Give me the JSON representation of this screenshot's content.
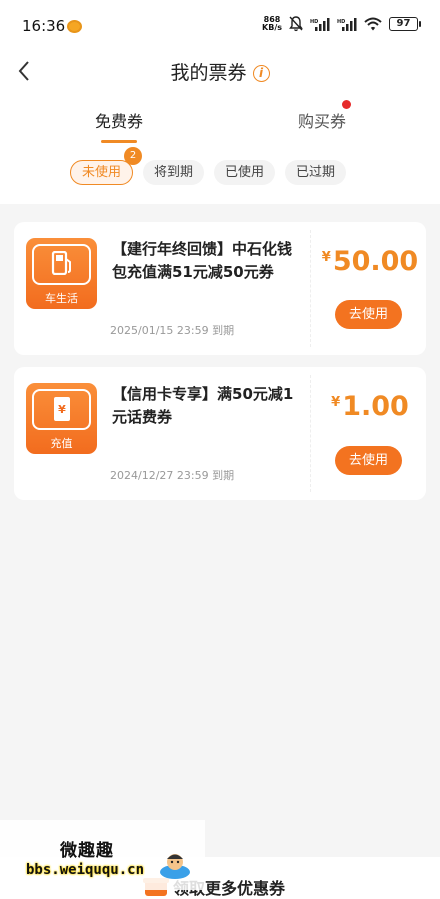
{
  "status_bar": {
    "time": "16:36",
    "speed_top": "868",
    "speed_bottom": "KB/s",
    "battery": "97"
  },
  "header": {
    "title": "我的票券",
    "info_glyph": "i"
  },
  "main_tabs": [
    {
      "label": "免费券",
      "active": true
    },
    {
      "label": "购买券",
      "active": false
    }
  ],
  "filters": [
    {
      "label": "未使用",
      "active": true,
      "badge": "2"
    },
    {
      "label": "将到期",
      "active": false
    },
    {
      "label": "已使用",
      "active": false
    },
    {
      "label": "已过期",
      "active": false
    }
  ],
  "coupons": [
    {
      "category": "车生活",
      "icon": "fuel-pump-icon",
      "title": "【建行年终回馈】中石化钱包充值满51元减50元券",
      "expiry": "2025/01/15 23:59 到期",
      "currency": "¥",
      "amount": "50.00",
      "button": "去使用"
    },
    {
      "category": "充值",
      "icon": "phone-yuan-icon",
      "title": "【信用卡专享】满50元减1元话费券",
      "expiry": "2024/12/27 23:59 到期",
      "currency": "¥",
      "amount": "1.00",
      "button": "去使用"
    }
  ],
  "bottom": {
    "more_label": "领取更多优惠券"
  },
  "watermark": {
    "line1": "微趣趣",
    "line2": "bbs.weiququ.cn"
  },
  "colors": {
    "accent": "#f08a24",
    "button": "#f37320",
    "badge_dot": "#e62b2b"
  }
}
